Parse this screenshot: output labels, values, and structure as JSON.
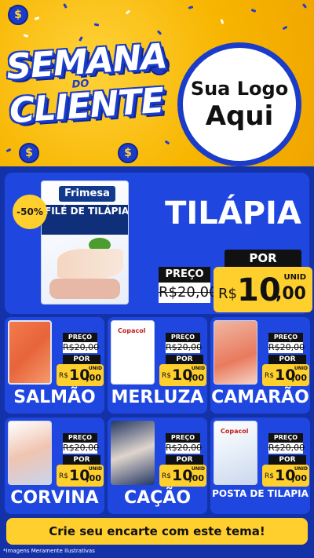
{
  "header": {
    "campaign_line1": "SEMANA",
    "campaign_line2": "DO",
    "campaign_line3": "CLIENTE",
    "logo_line1": "Sua Logo",
    "logo_line2": "Aqui"
  },
  "featured": {
    "discount": "-50%",
    "package_brand": "Frimesa",
    "package_title": "FILÉ DE TILÁPIA",
    "product_name": "TILÁPIA",
    "old_label": "PREÇO",
    "old_price": "R$20,00",
    "new_label": "POR",
    "currency": "R$",
    "price_int": "10",
    "price_cents": ",00",
    "unit": "UNID"
  },
  "products": [
    {
      "name": "SALMÃO",
      "old_label": "PREÇO",
      "old_price": "R$20,00",
      "new_label": "POR",
      "currency": "R$",
      "price_int": "10",
      "price_cents": ",00",
      "unit": "UNID",
      "image_brand": ""
    },
    {
      "name": "MERLUZA",
      "old_label": "PREÇO",
      "old_price": "R$20,00",
      "new_label": "POR",
      "currency": "R$",
      "price_int": "10",
      "price_cents": ",00",
      "unit": "UNID",
      "image_brand": "Copacol"
    },
    {
      "name": "CAMARÃO",
      "old_label": "PREÇO",
      "old_price": "R$20,00",
      "new_label": "POR",
      "currency": "R$",
      "price_int": "10",
      "price_cents": ",00",
      "unit": "UNID",
      "image_brand": ""
    },
    {
      "name": "CORVINA",
      "old_label": "PREÇO",
      "old_price": "R$20,00",
      "new_label": "POR",
      "currency": "R$",
      "price_int": "10",
      "price_cents": ",00",
      "unit": "UNID",
      "image_brand": ""
    },
    {
      "name": "CAÇÃO",
      "old_label": "PREÇO",
      "old_price": "R$20,00",
      "new_label": "POR",
      "currency": "R$",
      "price_int": "10",
      "price_cents": ",00",
      "unit": "UNID",
      "image_brand": ""
    },
    {
      "name": "POSTA DE TILAPIA",
      "old_label": "PREÇO",
      "old_price": "R$20,00",
      "new_label": "POR",
      "currency": "R$",
      "price_int": "10",
      "price_cents": ",00",
      "unit": "UNID",
      "image_brand": "Copacol"
    }
  ],
  "cta_label": "Crie seu encarte com este tema!",
  "footnote": "*Imagens Meramente Ilustrativas",
  "colors": {
    "background_yellow": "#f5b301",
    "panel_blue": "#1432a8",
    "card_blue": "#1f47e0",
    "price_yellow": "#ffcf2e"
  }
}
